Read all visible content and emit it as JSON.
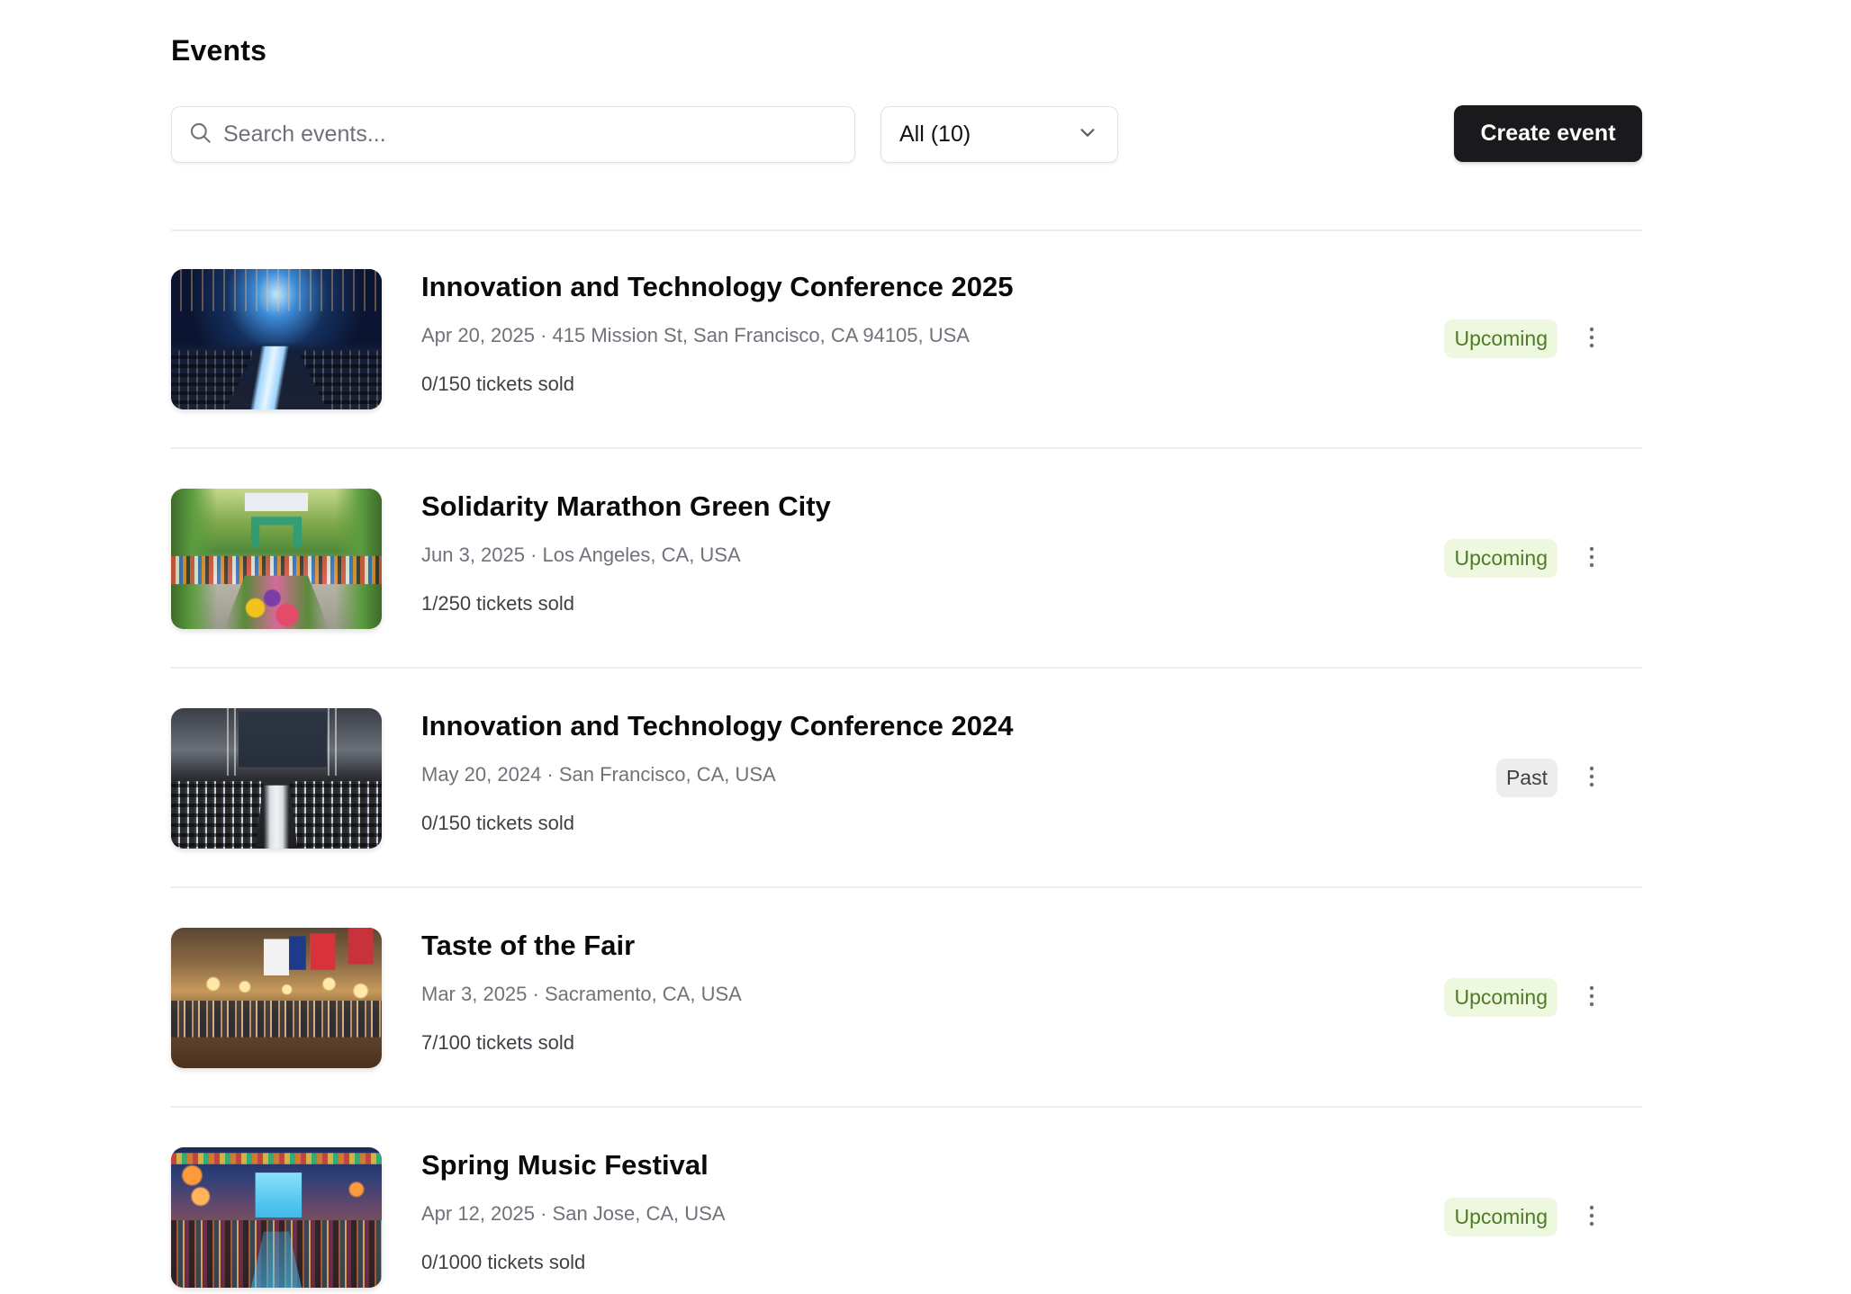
{
  "header": {
    "title": "Events"
  },
  "toolbar": {
    "search_placeholder": "Search events...",
    "search_value": "",
    "search_icon": "search-icon",
    "filter_value": "All (10)",
    "filter_icon": "chevron-down-icon",
    "create_label": "Create event"
  },
  "colors": {
    "primary_button": "#1a1a1c",
    "upcoming_badge_bg": "#eef8de",
    "upcoming_badge_text": "#4f7a28",
    "past_badge_bg": "#ededee",
    "past_badge_text": "#3f3f46"
  },
  "events": [
    {
      "title": "Innovation and Technology Conference 2025",
      "meta": "Apr 20, 2025 · 415 Mission St, San Francisco, CA 94105, USA",
      "tickets": "0/150 tickets sold",
      "status": "Upcoming",
      "status_kind": "upcoming",
      "image": "conference-hall-blue"
    },
    {
      "title": "Solidarity Marathon Green City",
      "meta": "Jun 3, 2025 · Los Angeles, CA, USA",
      "tickets": "1/250 tickets sold",
      "status": "Upcoming",
      "status_kind": "upcoming",
      "image": "marathon-park-green"
    },
    {
      "title": "Innovation and Technology Conference 2024",
      "meta": "May 20, 2024 · San Francisco, CA, USA",
      "tickets": "0/150 tickets sold",
      "status": "Past",
      "status_kind": "past",
      "image": "conference-hall-gray"
    },
    {
      "title": "Taste of the Fair",
      "meta": "Mar 3, 2025 · Sacramento, CA, USA",
      "tickets": "7/100 tickets sold",
      "status": "Upcoming",
      "status_kind": "upcoming",
      "image": "food-fair-hall"
    },
    {
      "title": "Spring Music Festival",
      "meta": "Apr 12, 2025 · San Jose, CA, USA",
      "tickets": "0/1000 tickets sold",
      "status": "Upcoming",
      "status_kind": "upcoming",
      "image": "music-festival-stage"
    }
  ],
  "row_menu_icon": "more-vertical-icon"
}
